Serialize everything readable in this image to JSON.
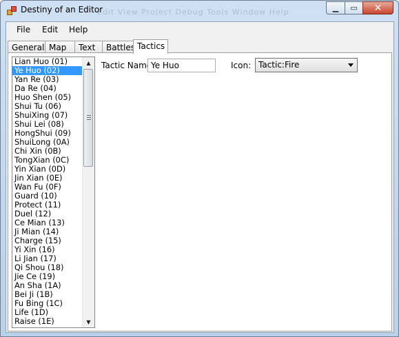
{
  "window": {
    "title": "Destiny of an Editor",
    "ghost_menu": "Edit   View   Project   Debug   Tools   Window   Help",
    "minimize_symbol": "▁",
    "maximize_symbol": "▭",
    "close_symbol": "✕"
  },
  "menu": {
    "file": "File",
    "edit": "Edit",
    "help": "Help"
  },
  "tabs": {
    "generals": "Generals",
    "map": "Map",
    "text": "Text",
    "battles": "Battles",
    "tactics": "Tactics"
  },
  "tactics_list": {
    "selected_index": 1,
    "items": [
      "Lian Huo (01)",
      "Ye Huo (02)",
      "Yan Re (03)",
      "Da Re (04)",
      "Huo Shen (05)",
      "Shui Tu (06)",
      "ShuiXing (07)",
      "Shui Lei (08)",
      "HongShui (09)",
      "ShuiLong (0A)",
      "Chi Xin (0B)",
      "TongXian (0C)",
      "Yin Xian (0D)",
      "Jin Xian (0E)",
      "Wan Fu (0F)",
      "Guard (10)",
      "Protect (11)",
      "Duel (12)",
      "Ce Mian (13)",
      "Ji Mian (14)",
      "Charge (15)",
      "Yi Xin (16)",
      "Li Jian (17)",
      "Qi Shou (18)",
      "Jie Ce (19)",
      "An Sha (1A)",
      "Bei Ji (1B)",
      "Fu Bing (1C)",
      "Life (1D)",
      "Raise (1E)"
    ]
  },
  "form": {
    "tactic_name_label": "Tactic Name:",
    "tactic_name_value": "Ye Huo",
    "icon_label": "Icon:",
    "icon_value": "Tactic:Fire"
  },
  "colors": {
    "selection": "#3399ff",
    "close_button": "#c8442c"
  }
}
